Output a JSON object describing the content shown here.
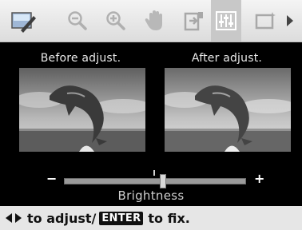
{
  "toolbar": {
    "items": [
      {
        "icon": "edit-photo-icon"
      },
      {
        "icon": "zoom-out-icon"
      },
      {
        "icon": "zoom-in-icon"
      },
      {
        "icon": "hand-icon"
      },
      {
        "icon": "rotate-icon"
      },
      {
        "icon": "adjust-icon",
        "active": true
      },
      {
        "icon": "frame-icon"
      },
      {
        "icon": "scroll-right-icon"
      }
    ]
  },
  "preview": {
    "before_label": "Before adjust.",
    "after_label": "After adjust."
  },
  "slider": {
    "minus": "−",
    "plus": "+",
    "label": "Brightness",
    "value_fraction": 0.55,
    "default_fraction": 0.5
  },
  "hint": {
    "adjust_text": "to adjust/",
    "enter_key": "ENTER",
    "fix_text": "to fix."
  },
  "colors": {
    "toolbar_bg": "#e2e2e2",
    "active_tool_bg": "#c8c8c8",
    "screen_bg": "#000000",
    "hint_bar_bg": "#e6e6e6"
  }
}
